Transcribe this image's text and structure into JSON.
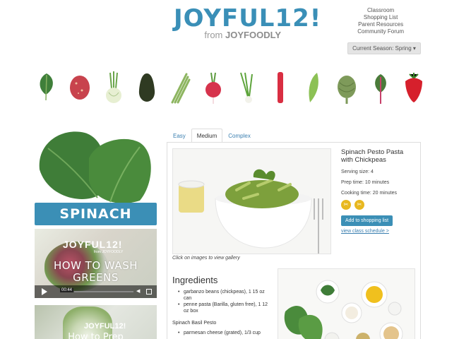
{
  "header": {
    "logo_main": "JOYFUL12!",
    "logo_from": "from",
    "logo_brand": "JOYFOODLY",
    "nav": [
      "Classroom",
      "Shopping List",
      "Parent Resources",
      "Community Forum"
    ],
    "season_label": "Current Season: Spring ▾"
  },
  "produce": [
    "spinach",
    "potato",
    "fennel",
    "avocado",
    "asparagus",
    "radish",
    "green-onion",
    "rhubarb",
    "snap-pea",
    "artichoke",
    "chard",
    "strawberry"
  ],
  "left": {
    "vegetable_name": "SPINACH",
    "video1": {
      "logo": "JOYFUL12!",
      "sub": "from JOYFOODLY",
      "title": "HOW TO WASH GREENS",
      "time": "00:44"
    },
    "video2": {
      "logo": "JOYFUL12!",
      "title": "How to Prep"
    }
  },
  "tabs": [
    {
      "label": "Easy",
      "active": false
    },
    {
      "label": "Medium",
      "active": true
    },
    {
      "label": "Complex",
      "active": false
    }
  ],
  "recipe": {
    "caption": "Click on images to view gallery",
    "title": "Spinach Pesto Pasta with Chickpeas",
    "serving": "Serving size: 4",
    "prep": "Prep time: 10 minutes",
    "cooking": "Cooking time: 20 minutes",
    "add_button": "Add to shopping list",
    "schedule_link": "view class schedule >",
    "ingredients_title": "Ingredients",
    "ingredients": [
      "garbanzo beans (chickpeas), 1 15 oz can",
      "penne pasta (Barilla, gluten free), 1 12 oz box"
    ],
    "pesto_title": "Spinach Basil Pesto",
    "pesto_ingredients": [
      "parmesan cheese (grated), 1/3 cup"
    ]
  },
  "colors": {
    "brand_blue": "#3b8fb6",
    "badge_yellow": "#e8b820",
    "link_blue": "#3a7fb0"
  }
}
